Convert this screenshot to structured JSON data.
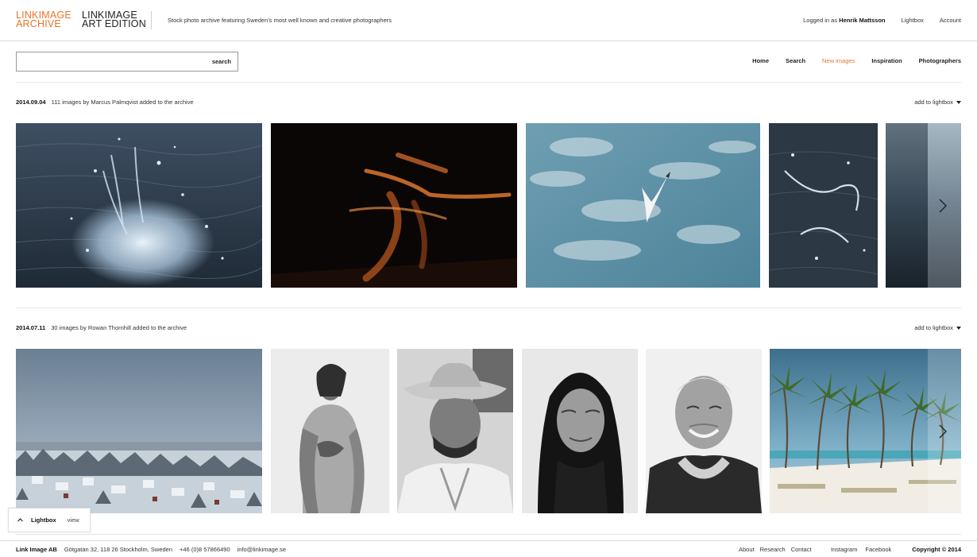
{
  "header": {
    "logo_archive": [
      "LINKIMAGE",
      "ARCHIVE"
    ],
    "logo_art": [
      "LINKIMAGE",
      "ART EDITION"
    ],
    "tagline": "Stock photo archive featuring Sweden's most well known and creative photographers",
    "logged_in_prefix": "Logged in as",
    "user_name": "Henrik Mattsson",
    "lightbox_link": "Lightbox",
    "account_link": "Account"
  },
  "search": {
    "value": "",
    "button_label": "search"
  },
  "nav": {
    "home": "Home",
    "search": "Search",
    "new_images": "New images",
    "inspiration": "Inspiration",
    "photographers": "Photographers",
    "active": "New images"
  },
  "sections": [
    {
      "date": "2014.09.04",
      "description": "111 images by Marcus Palmqvist added to the archive",
      "add_to_lightbox": "add to lightbox",
      "images": [
        "water-splash",
        "blurred-dancer",
        "seagull-in-sky",
        "water-splash-detail",
        "calm-water"
      ]
    },
    {
      "date": "2014.07.11",
      "description": "30 images by Rowan Thornhill added to the archive",
      "add_to_lightbox": "add to lightbox",
      "images": [
        "snowy-village",
        "girl-in-blanket",
        "man-in-cowboy-hat",
        "woman-in-headscarf",
        "smiling-old-man",
        "palm-beach"
      ]
    }
  ],
  "lightbox_tab": {
    "label": "Lightbox",
    "view": "view"
  },
  "footer": {
    "company": "Link Image AB",
    "address": "Götgatan 32, 118 26 Stockholm, Sweden",
    "phone": "+46 (0)8 57866490",
    "email": "info@linkimage.se",
    "about": "About",
    "research": "Research",
    "contact": "Contact",
    "instagram": "Instagram",
    "facebook": "Facebook",
    "copyright": "Copyright © 2014"
  },
  "colors": {
    "accent": "#e8742c",
    "text": "#222222",
    "rule": "#e6e6e6"
  }
}
